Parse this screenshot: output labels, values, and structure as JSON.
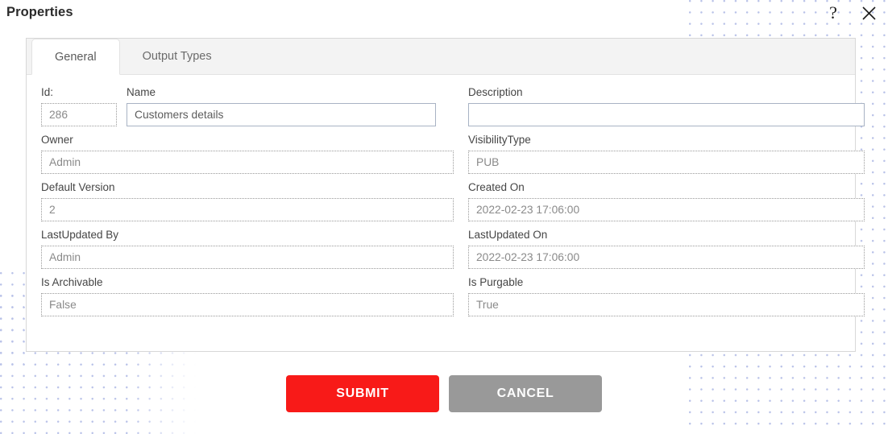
{
  "window": {
    "title": "Properties",
    "help_icon": "question-mark-icon",
    "close_icon": "close-icon",
    "help_glyph": "?"
  },
  "tabs": [
    {
      "label": "General",
      "active": true
    },
    {
      "label": "Output Types",
      "active": false
    }
  ],
  "form": {
    "fields": [
      {
        "key": "id",
        "label": "Id:",
        "value": "286",
        "readonly": true,
        "column": "left"
      },
      {
        "key": "name",
        "label": "Name",
        "value": "Customers details",
        "readonly": false,
        "column": "left"
      },
      {
        "key": "description",
        "label": "Description",
        "value": "",
        "readonly": false,
        "column": "right"
      },
      {
        "key": "owner",
        "label": "Owner",
        "value": "Admin",
        "readonly": true,
        "column": "left"
      },
      {
        "key": "visibility_type",
        "label": "VisibilityType",
        "value": "PUB",
        "readonly": true,
        "column": "right"
      },
      {
        "key": "default_version",
        "label": "Default Version",
        "value": "2",
        "readonly": true,
        "column": "left"
      },
      {
        "key": "created_on",
        "label": "Created On",
        "value": "2022-02-23 17:06:00",
        "readonly": true,
        "column": "right"
      },
      {
        "key": "lastupdated_by",
        "label": "LastUpdated By",
        "value": "Admin",
        "readonly": true,
        "column": "left"
      },
      {
        "key": "lastupdated_on",
        "label": "LastUpdated On",
        "value": "2022-02-23 17:06:00",
        "readonly": true,
        "column": "right"
      },
      {
        "key": "is_archivable",
        "label": "Is Archivable",
        "value": "False",
        "readonly": true,
        "column": "left"
      },
      {
        "key": "is_purgable",
        "label": "Is Purgable",
        "value": "True",
        "readonly": true,
        "column": "right"
      }
    ]
  },
  "footer": {
    "submit_label": "SUBMIT",
    "cancel_label": "CANCEL"
  },
  "colors": {
    "submit_red": "#F81A18",
    "cancel_gray": "#999999",
    "pattern_dot": "#B9C2E8",
    "tabstrip_bg": "#F3F3F3",
    "panel_border": "#D8D8D8"
  }
}
